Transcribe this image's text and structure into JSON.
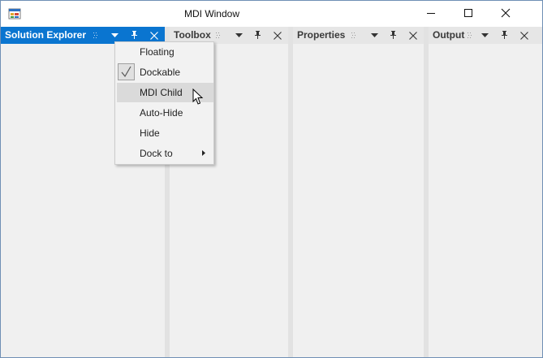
{
  "window": {
    "title": "MDI Window"
  },
  "titlebar_buttons": [
    {
      "name": "minimize-button",
      "icon": "minimize-icon"
    },
    {
      "name": "maximize-button",
      "icon": "maximize-icon"
    },
    {
      "name": "close-button",
      "icon": "close-icon"
    }
  ],
  "panes": [
    {
      "title": "Solution Explorer",
      "active": true
    },
    {
      "title": "Toolbox",
      "active": false
    },
    {
      "title": "Properties",
      "active": false
    },
    {
      "title": "Output",
      "active": false
    }
  ],
  "menu": {
    "items": [
      {
        "label": "Floating",
        "checked": false,
        "hovered": false,
        "submenu": false
      },
      {
        "label": "Dockable",
        "checked": true,
        "hovered": false,
        "submenu": false
      },
      {
        "label": "MDI Child",
        "checked": false,
        "hovered": true,
        "submenu": false
      },
      {
        "label": "Auto-Hide",
        "checked": false,
        "hovered": false,
        "submenu": false
      },
      {
        "label": "Hide",
        "checked": false,
        "hovered": false,
        "submenu": false
      },
      {
        "label": "Dock to",
        "checked": false,
        "hovered": false,
        "submenu": true
      }
    ]
  },
  "colors": {
    "active_header": "#0a75d0",
    "inactive_header": "#e6e6e6",
    "pane_background": "#f0f0f0",
    "menu_hover": "#dadada"
  }
}
